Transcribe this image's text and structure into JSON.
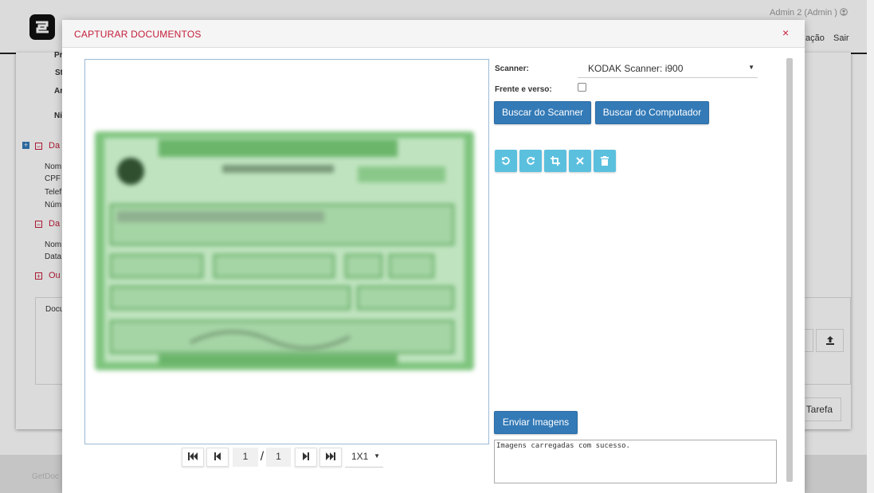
{
  "background": {
    "user": "Admin 2 (Admin )",
    "nav": {
      "item1": "ação",
      "item2": "Sair"
    },
    "fields": [
      "Pr",
      "St",
      "Ar",
      "Ni"
    ],
    "section1": "Da",
    "section1_fields": [
      "Nom",
      "CPF",
      "Telef",
      "Núm"
    ],
    "section2": "Da",
    "section2_fields": [
      "Nom",
      "Data"
    ],
    "section3": "Ou",
    "doc_box_label": "Docu",
    "task_button": "Tarefa",
    "footer": "GetDoc"
  },
  "modal": {
    "title": "CAPTURAR DOCUMENTOS",
    "close": "×",
    "scanner_label": "Scanner:",
    "scanner_value": "KODAK Scanner: i900",
    "duplex_label": "Frente e verso:",
    "duplex_checked": false,
    "btn_scan": "Buscar do Scanner",
    "btn_computer": "Buscar do Computador",
    "tools": [
      "rotate-left-icon",
      "rotate-right-icon",
      "crop-icon",
      "close-icon",
      "trash-icon"
    ],
    "tool_glyphs": [
      "↺",
      "↻",
      "⌗",
      "✖",
      "🗑"
    ],
    "send_button": "Enviar Imagens",
    "log_text": "Imagens carregadas com sucesso.",
    "pager": {
      "first": "⏮",
      "prev": "⏴",
      "current": "1",
      "sep": "/",
      "total": "1",
      "next": "⏵",
      "last": "⏭",
      "zoom": "1X1"
    },
    "colors": {
      "accent": "#c41e3a",
      "primary": "#337ab7",
      "info": "#5bc0de"
    }
  }
}
